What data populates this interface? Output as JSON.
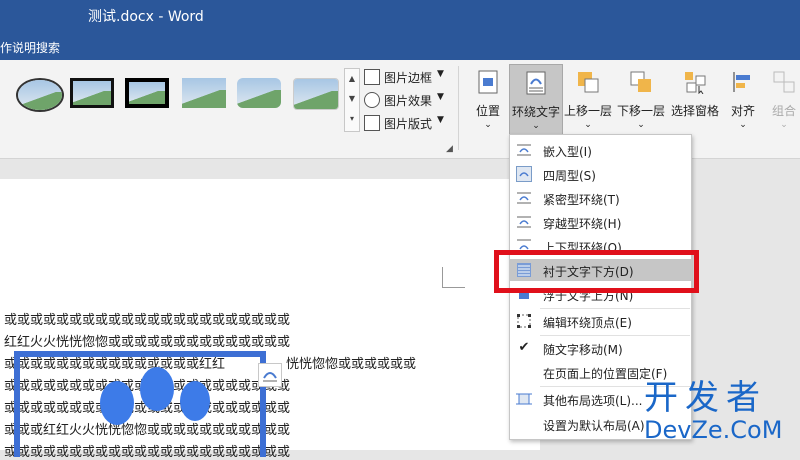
{
  "window": {
    "title": "测试.docx - Word"
  },
  "tellme": {
    "label": "作说明搜索"
  },
  "ribbon": {
    "picture_commands": [
      {
        "label": "图片边框",
        "icon": "picture-border-icon"
      },
      {
        "label": "图片效果",
        "icon": "picture-effects-icon"
      },
      {
        "label": "图片版式",
        "icon": "picture-layout-icon"
      }
    ],
    "arrange": {
      "position": "位置",
      "wrap_text": "环绕文字",
      "bring_forward": "上移一层",
      "send_backward": "下移一层",
      "selection_pane": "选择窗格",
      "align": "对齐",
      "group": "组合"
    }
  },
  "document": {
    "lines": [
      "或或或或或或或或或或或或或或或或或或或或或或",
      "红红火火恍恍惚惚或或或或或或或或或或或或或或",
      "或或或或或或或或或或或或或或或红红",
      "或或或或或或或或或或或或或或或或或或或或或或",
      "或或或或或或或或或或或或或或或或或或或或或或",
      "或或或红红火火恍恍惚惚或或或或或或或或或或或",
      "或或或或或或或或或或或或或或或或或或或或或或"
    ],
    "line3_tail": "恍恍惚惚或或或或或或"
  },
  "wrap_menu": {
    "items": [
      {
        "label": "嵌入型(I)",
        "icon": "inline-wrap-icon"
      },
      {
        "label": "四周型(S)",
        "icon": "square-wrap-icon"
      },
      {
        "label": "紧密型环绕(T)",
        "icon": "tight-wrap-icon"
      },
      {
        "label": "穿越型环绕(H)",
        "icon": "through-wrap-icon"
      },
      {
        "label": "上下型环绕(O)",
        "icon": "top-bottom-wrap-icon"
      },
      {
        "label": "衬于文字下方(D)",
        "icon": "behind-text-icon"
      },
      {
        "label": "浮于文字上方(N)",
        "icon": "in-front-of-text-icon"
      },
      {
        "label": "编辑环绕顶点(E)",
        "icon": "edit-wrap-points-icon"
      },
      {
        "label": "随文字移动(M)",
        "icon": "checkmark-icon"
      },
      {
        "label": "在页面上的位置固定(F)",
        "icon": ""
      },
      {
        "label": "其他布局选项(L)...",
        "icon": "more-layout-options-icon"
      },
      {
        "label": "设置为默认布局(A)",
        "icon": ""
      }
    ],
    "highlighted": "衬于文字下方(D)"
  },
  "watermark": {
    "line1": "开发者",
    "line2": "DevZe.CoM"
  },
  "colors": {
    "title_bar": "#2b579a",
    "highlight_box": "#e0101b",
    "watermark": "#1a67c8"
  }
}
